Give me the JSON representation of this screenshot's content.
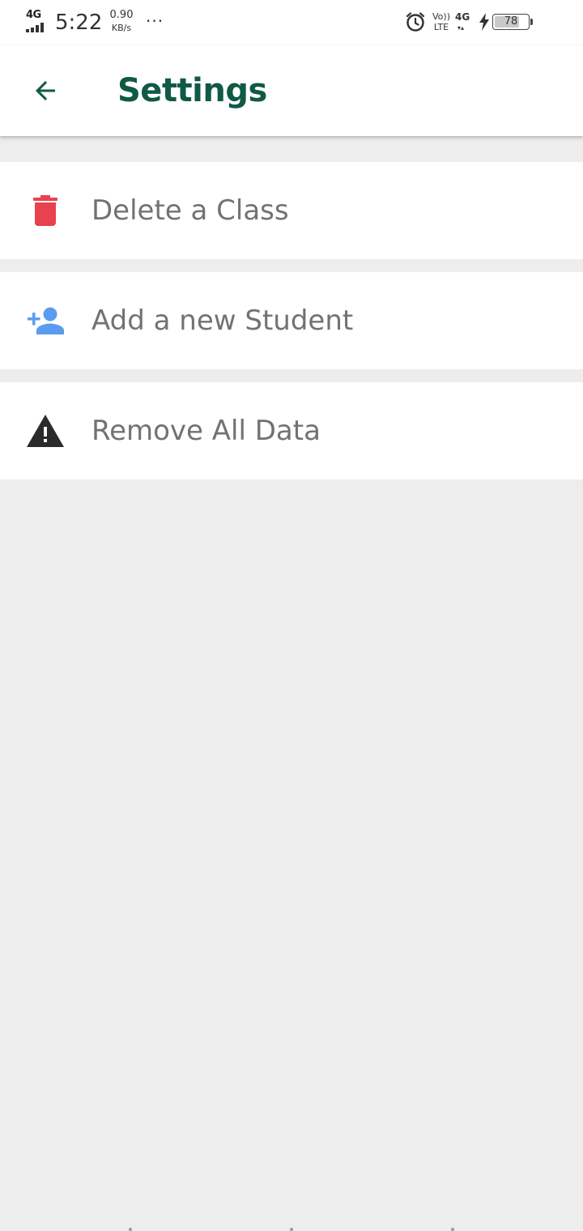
{
  "status_bar": {
    "network_type": "4G",
    "time": "5:22",
    "speed_value": "0.90",
    "speed_unit": "KB/s",
    "overflow": "···",
    "volte_top": "Vo))",
    "volte_bottom": "LTE",
    "network_type_2": "4G",
    "network_arrows": "▾▴",
    "battery_level": "78",
    "battery_fraction": 0.78
  },
  "app_bar": {
    "title": "Settings",
    "back_icon": "arrow-back-icon",
    "title_color": "#0f5a45"
  },
  "menu": {
    "items": [
      {
        "label": "Delete a Class",
        "icon": "delete-icon",
        "icon_color": "#e8414f"
      },
      {
        "label": "Add a new Student",
        "icon": "person-add-icon",
        "icon_color": "#5b9cf0"
      },
      {
        "label": "Remove All Data",
        "icon": "warning-icon",
        "icon_color": "#2b2b2b"
      }
    ]
  },
  "colors": {
    "background": "#ededed",
    "surface": "#ffffff",
    "label_text": "#727272"
  }
}
